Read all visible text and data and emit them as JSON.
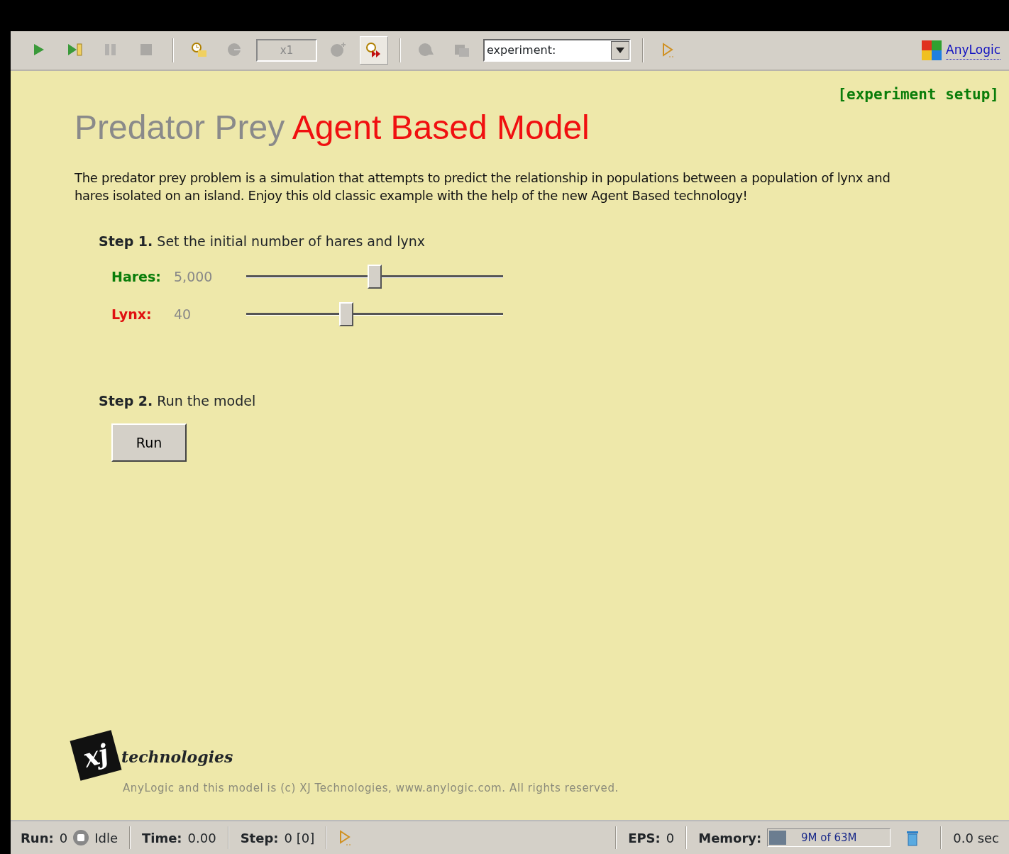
{
  "toolbar": {
    "left": [
      {
        "kind": "button",
        "disabled": false,
        "pressed": false
      },
      {
        "kind": "button",
        "disabled": false,
        "pressed": false
      },
      {
        "kind": "button",
        "disabled": true,
        "pressed": false
      },
      {
        "kind": "button",
        "disabled": true,
        "pressed": false
      },
      {
        "kind": "separator"
      },
      {
        "kind": "button",
        "disabled": false,
        "pressed": false
      },
      {
        "kind": "button",
        "disabled": true,
        "pressed": false
      },
      {
        "kind": "field",
        "value": "x1",
        "disabled": true
      },
      {
        "kind": "button",
        "disabled": true,
        "pressed": false
      },
      {
        "kind": "button",
        "disabled": false,
        "pressed": true
      },
      {
        "kind": "separator"
      },
      {
        "kind": "button",
        "disabled": true,
        "pressed": false
      },
      {
        "kind": "button",
        "disabled": true,
        "pressed": false
      },
      {
        "kind": "dropdown",
        "value": "experiment:"
      },
      {
        "kind": "separator"
      },
      {
        "kind": "button",
        "disabled": false,
        "pressed": false
      }
    ],
    "brand_link": "AnyLogic"
  },
  "setup_link": "[experiment setup]",
  "title": {
    "grey": "Predator Prey",
    "red": "Agent Based Model"
  },
  "description": "The predator prey problem is a simulation that attempts to predict the relationship in populations between a population of lynx and hares isolated on an island. Enjoy this old classic example with the help of the new Agent Based technology!",
  "step1": "**Step 1.** Set the initial number of hares and lynx",
  "sliders": [
    {
      "label": "Hares:",
      "color": "#0a7d0a",
      "value": "5,000",
      "level": 0.5
    },
    {
      "label": "Lynx:",
      "color": "#e01010",
      "value": "40",
      "level": 0.39
    }
  ],
  "step2": "**Step 2.** Run the model",
  "run_button": "Run",
  "footer": {
    "logo_letters": "xj",
    "logo_word": "technologies",
    "copyright": "AnyLogic and this model is (c) XJ Technologies, www.anylogic.com. All rights reserved."
  },
  "status_bar": {
    "run_label": "Run:",
    "run_value": "0",
    "running": false,
    "state": "Idle",
    "time_label": "Time:",
    "time_value": "0.00",
    "step_label": "Step:",
    "step_value": "0 [0]",
    "eps_label": "EPS:",
    "eps_value": "0",
    "memory_label": "Memory:",
    "memory_text": "9M of 63M",
    "memory": {
      "level": 0.14
    },
    "elapsed": "0.0 sec"
  }
}
